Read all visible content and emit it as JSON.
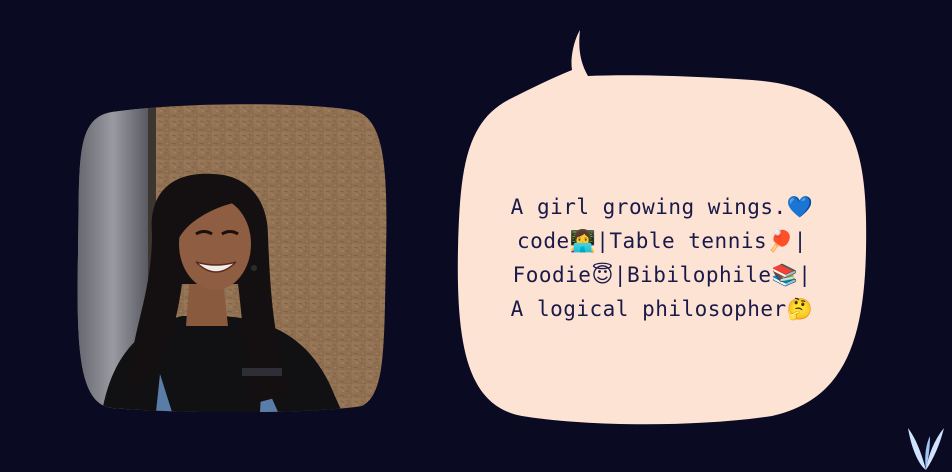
{
  "bio": {
    "lines": [
      {
        "text": "A girl growing wings.",
        "emoji": "💙"
      },
      {
        "text": "code",
        "emoji": "👩‍💻",
        "text2": "|Table tennis",
        "emoji2": "🏓",
        "text3": "|"
      },
      {
        "text": "Foodie",
        "emoji": "😇",
        "text2": "|Bibilophile",
        "emoji2": "📚",
        "text3": "|"
      },
      {
        "text": "A logical philosopher",
        "emoji": "🤔"
      }
    ]
  },
  "colors": {
    "background": "#0a0a22",
    "bubble": "#fde3d4",
    "text": "#1a1a4a",
    "logo": "#cfe3ff"
  },
  "icons": {
    "corner_logo": "v-logo-icon",
    "profile_photo": "profile-photo"
  }
}
